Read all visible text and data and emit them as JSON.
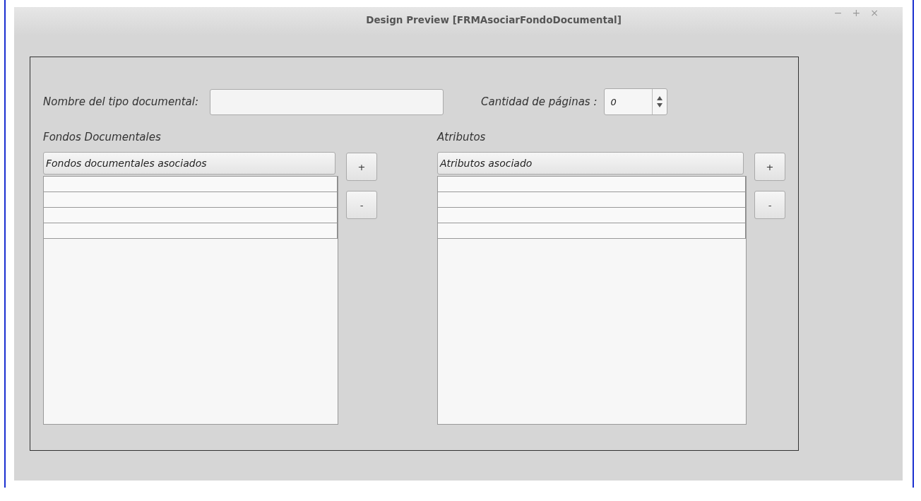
{
  "window": {
    "title": "Design Preview [FRMAsociarFondoDocumental]",
    "controls": [
      "−",
      "+",
      "×"
    ]
  },
  "form": {
    "name_label": "Nombre del tipo documental:",
    "pages_label": "Cantidad de páginas :",
    "pages_value": "0"
  },
  "panels": [
    {
      "title": "Fondos Documentales",
      "column": "Fondos documentales asociados",
      "buttons": [
        "+",
        "-"
      ],
      "rows": [
        {
          "kind": "empty"
        },
        {
          "kind": "empty"
        },
        {
          "kind": "empty"
        },
        {
          "kind": "empty"
        }
      ]
    },
    {
      "title": "Atributos",
      "column": "Atributos asociado",
      "buttons": [
        "+",
        "-"
      ],
      "rows": [
        {
          "kind": "empty"
        },
        {
          "kind": "empty"
        },
        {
          "kind": "empty"
        },
        {
          "kind": "empty"
        }
      ]
    }
  ]
}
